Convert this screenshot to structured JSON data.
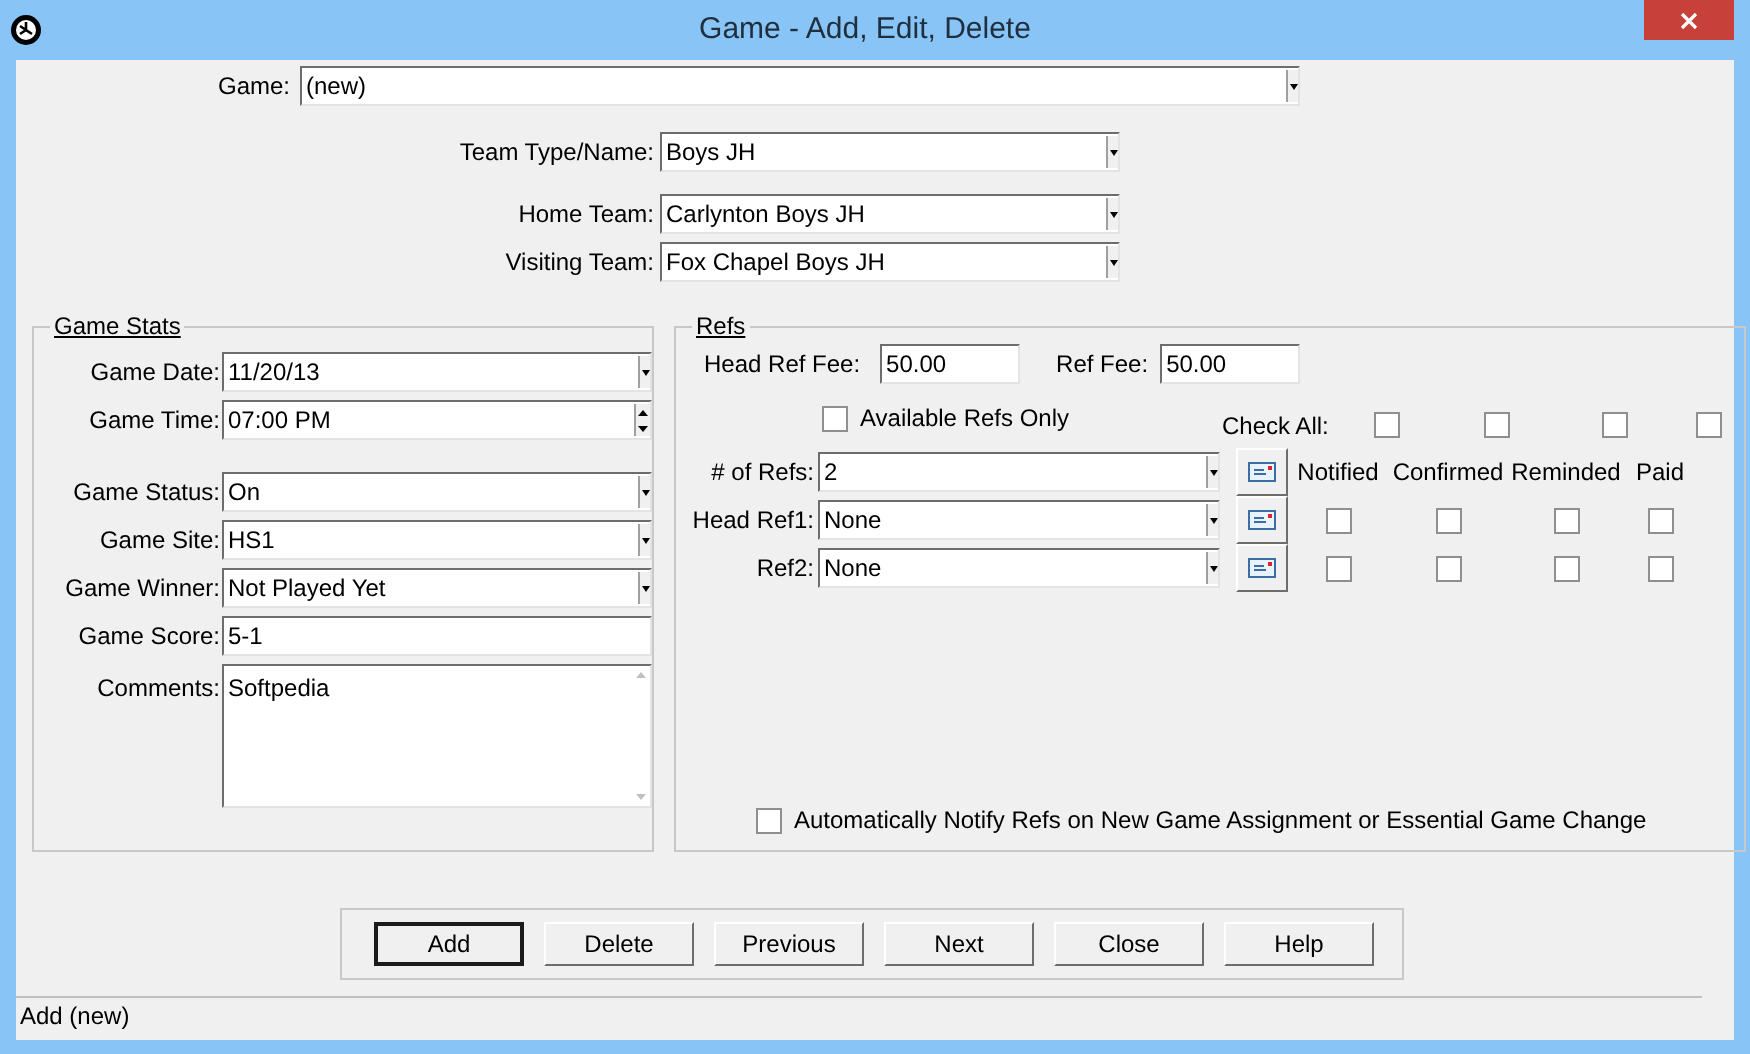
{
  "window": {
    "title": "Game - Add, Edit, Delete"
  },
  "game": {
    "label": "Game:",
    "value": "(new)"
  },
  "teams": [
    {
      "label": "Team Type/Name:",
      "value": "Boys JH"
    },
    {
      "label": "Home Team:",
      "value": "Carlynton Boys JH"
    },
    {
      "label": "Visiting Team:",
      "value": "Fox Chapel Boys JH"
    }
  ],
  "game_stats": {
    "title": "Game Stats",
    "fields": [
      {
        "kind": "combo",
        "label": "Game Date:",
        "value": "11/20/13"
      },
      {
        "kind": "spin",
        "label": "Game Time:",
        "value": "07:00 PM"
      },
      {
        "kind": "combo",
        "label": "Game Status:",
        "value": "On"
      },
      {
        "kind": "combo",
        "label": "Game Site:",
        "value": "HS1"
      },
      {
        "kind": "combo",
        "label": "Game Winner:",
        "value": "Not Played Yet"
      },
      {
        "kind": "text",
        "label": "Game Score:",
        "value": "5-1"
      },
      {
        "kind": "memo",
        "label": "Comments:",
        "value": "Softpedia"
      }
    ]
  },
  "refs": {
    "title": "Refs",
    "head_ref_fee": {
      "label": "Head Ref Fee:",
      "value": "50.00"
    },
    "ref_fee": {
      "label": "Ref Fee:",
      "value": "50.00"
    },
    "available_only": {
      "label": "Available Refs Only",
      "checked": false
    },
    "check_all": {
      "label": "Check All:",
      "checks": [
        {
          "checked": false
        },
        {
          "checked": false
        },
        {
          "checked": false
        },
        {
          "checked": false
        }
      ]
    },
    "count": {
      "label": "# of Refs:",
      "value": "2"
    },
    "columns": [
      "Notified",
      "Confirmed",
      "Reminded",
      "Paid"
    ],
    "rows": [
      {
        "label": "Head Ref1:",
        "value": "None",
        "checks": [
          {
            "checked": false
          },
          {
            "checked": false
          },
          {
            "checked": false
          },
          {
            "checked": false
          }
        ]
      },
      {
        "label": "Ref2:",
        "value": "None",
        "checks": [
          {
            "checked": false
          },
          {
            "checked": false
          },
          {
            "checked": false
          },
          {
            "checked": false
          }
        ]
      }
    ],
    "auto_notify": {
      "label": "Automatically Notify Refs on New Game Assignment or Essential Game Change",
      "checked": false
    }
  },
  "buttons": [
    {
      "label": "Add",
      "default": true
    },
    {
      "label": "Delete",
      "default": false
    },
    {
      "label": "Previous",
      "default": false
    },
    {
      "label": "Next",
      "default": false
    },
    {
      "label": "Close",
      "default": false
    },
    {
      "label": "Help",
      "default": false
    }
  ],
  "status_bar": {
    "text": "Add (new)"
  }
}
